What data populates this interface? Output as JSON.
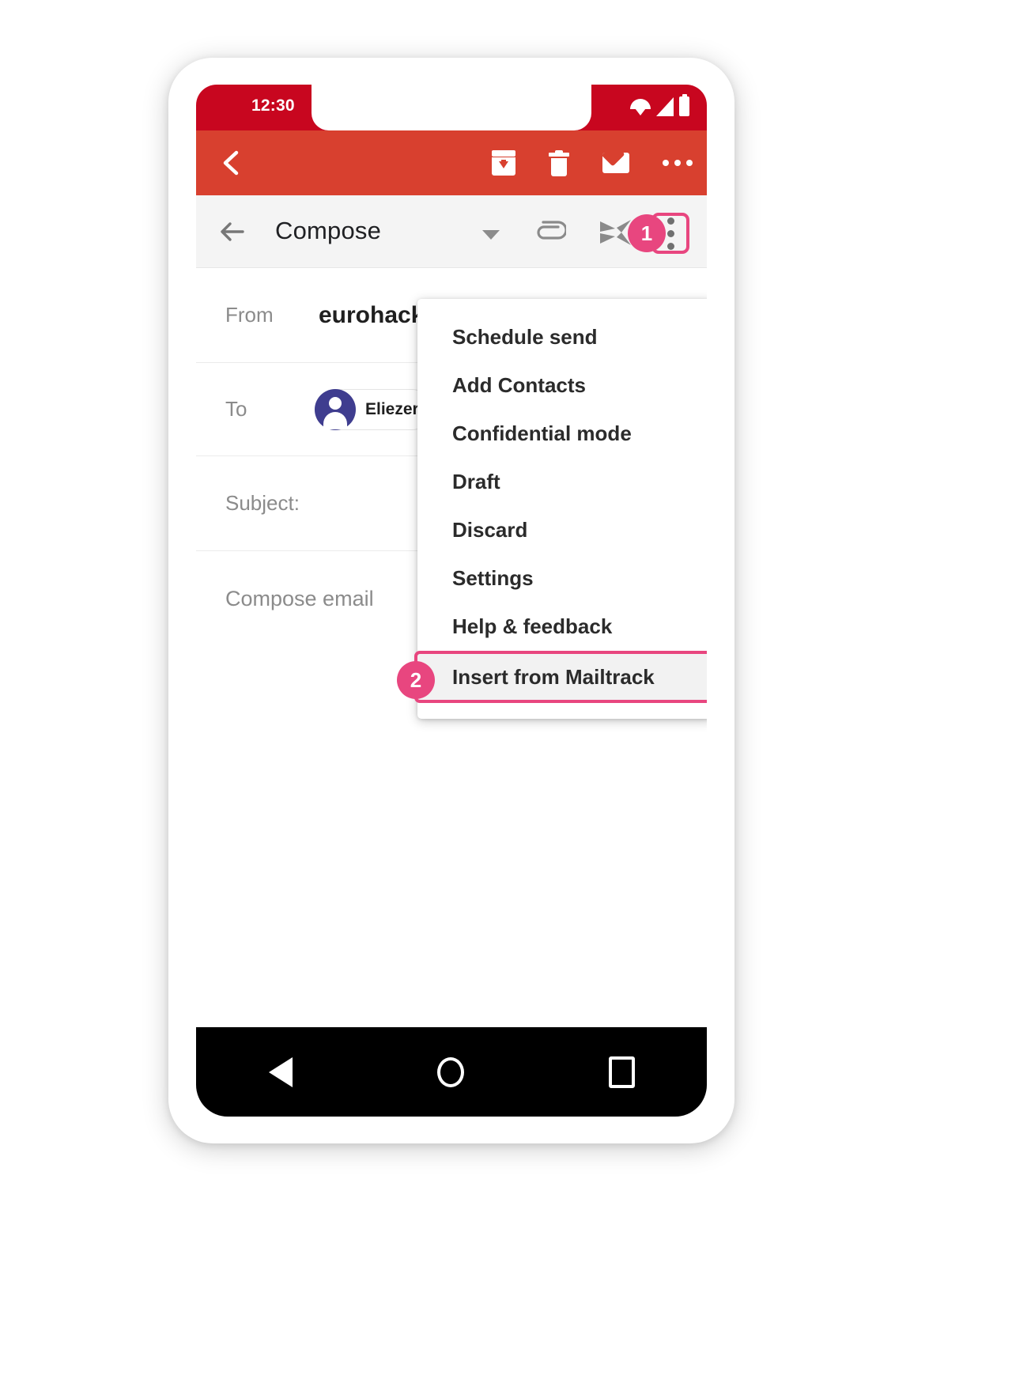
{
  "status_bar": {
    "time": "12:30",
    "icons": [
      "wifi-icon",
      "signal-icon",
      "battery-icon"
    ]
  },
  "app_bar": {
    "back_icon": "chevron-left-icon",
    "actions": [
      {
        "name": "archive-icon",
        "label": "Archive"
      },
      {
        "name": "delete-icon",
        "label": "Delete"
      },
      {
        "name": "mark-unread-icon",
        "label": "Mark unread"
      },
      {
        "name": "more-horizontal-icon",
        "label": "More options"
      }
    ]
  },
  "compose_bar": {
    "back_icon": "arrow-left-icon",
    "title": "Compose",
    "caret_icon": "chevron-down-icon",
    "attach_icon": "paperclip-icon",
    "send_icon": "send-icon",
    "overflow_icon": "more-vertical-icon",
    "step_badge": "1"
  },
  "form": {
    "from": {
      "label": "From",
      "value": "eurohack"
    },
    "to": {
      "label": "To",
      "recipient": "Eliezer"
    },
    "subject": {
      "label": "Subject:",
      "value": ""
    },
    "body": {
      "placeholder": "Compose email",
      "value": ""
    }
  },
  "dropdown": {
    "items": [
      {
        "label": "Schedule send",
        "highlighted": false
      },
      {
        "label": "Add Contacts",
        "highlighted": false
      },
      {
        "label": "Confidential mode",
        "highlighted": false
      },
      {
        "label": "Draft",
        "highlighted": false
      },
      {
        "label": "Discard",
        "highlighted": false
      },
      {
        "label": "Settings",
        "highlighted": false
      },
      {
        "label": "Help & feedback",
        "highlighted": false
      },
      {
        "label": "Insert from Mailtrack",
        "highlighted": true
      }
    ],
    "step_badge": "2"
  },
  "nav_bar": {
    "back": "triangle-back-icon",
    "home": "circle-home-icon",
    "recents": "square-recents-icon"
  },
  "colors": {
    "status_red": "#c8061f",
    "app_bar_red": "#d8402f",
    "accent_pink": "#e8467f",
    "avatar_purple": "#3f3d8f",
    "compose_bar_gray": "#f4f4f4"
  }
}
